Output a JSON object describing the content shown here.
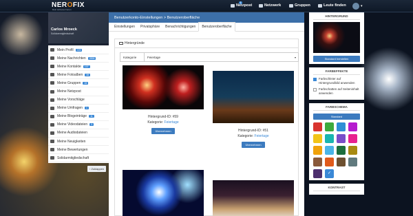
{
  "topbar": {
    "logo_main": "NER",
    "logo_x": "O",
    "logo_rest": "FIX",
    "logo_sub": "Dein sicheres Forum",
    "nav": [
      {
        "label": "Netzpost",
        "badge": "1"
      },
      {
        "label": "Netzwerk"
      },
      {
        "label": "Gruppen"
      },
      {
        "label": "Leute finden"
      }
    ]
  },
  "profile": {
    "name": "Carlos Mroeck",
    "sub": "Solidaremigliedschaft"
  },
  "sidebar": {
    "items": [
      {
        "label": "Mein Profil",
        "count": "378"
      },
      {
        "label": "Meine Nachrichten",
        "count": "2899"
      },
      {
        "label": "Meine Kontakte",
        "count": "107"
      },
      {
        "label": "Meine Fotoalben",
        "count": "38"
      },
      {
        "label": "Meine Gruppen",
        "count": "15"
      },
      {
        "label": "Meine Netzpost",
        "count": ""
      },
      {
        "label": "Meine Vorschläge",
        "count": ""
      },
      {
        "label": "Meine Umfragen",
        "count": "1"
      },
      {
        "label": "Meine Blogeinträge",
        "count": "11"
      },
      {
        "label": "Meine Videodateien",
        "count": "3"
      },
      {
        "label": "Meine Audiodateien",
        "count": ""
      },
      {
        "label": "Meine Neuigkeiten",
        "count": ""
      },
      {
        "label": "Meine Bewertungen",
        "count": ""
      },
      {
        "label": "Solidarmitgliedschaft",
        "count": ""
      }
    ],
    "collapse_label": "Zuklappen"
  },
  "main": {
    "breadcrumb": "Benutzerkonto-Einstellungen > Benutzeroberfläche",
    "tabs": [
      "Einstellungen",
      "Privatsphäre",
      "Benachrichtigungen",
      "Benutzeroberfläche"
    ],
    "panel_title": "Hintergründe",
    "kategorie_label": "Kategorie",
    "kategorie_value": "Feiertage",
    "cards": [
      {
        "id": "Hintergrund-ID: #59",
        "cat_label": "Kategorie:",
        "cat": "Feiertage",
        "button": "Übernehmen"
      },
      {
        "id": "Hintergrund-ID: #51",
        "cat_label": "Kategorie:",
        "cat": "Feiertage",
        "button": "Übernehmen"
      }
    ]
  },
  "right": {
    "hintergrund_title": "HINTERGRUND",
    "hintergrund_btn": "Standard herstellen",
    "farbeffekte_title": "FARBEFFEKTE",
    "opt1": "Farbschleier auf Hintergrundbild anwenden",
    "opt2": "Farbschatten auf Seiteninhalt anwenden",
    "farbschema_title": "FARBSCHEMA",
    "standard_btn": "Standard",
    "swatch_colors": [
      "#d9352f",
      "#3daa3d",
      "#2f8fd6",
      "#b61cce",
      "#f2c418",
      "#19b6b0",
      "#7a4ec9",
      "#e8218f",
      "#f0a20b",
      "#4ab4e6",
      "#1d6e3d",
      "#a88a12",
      "#8a5a3a",
      "#e05a1a",
      "#6d5030",
      "#607a7e",
      "#4d2f6e",
      "#3a88d6"
    ],
    "kontrast_title": "KONTRAST"
  }
}
